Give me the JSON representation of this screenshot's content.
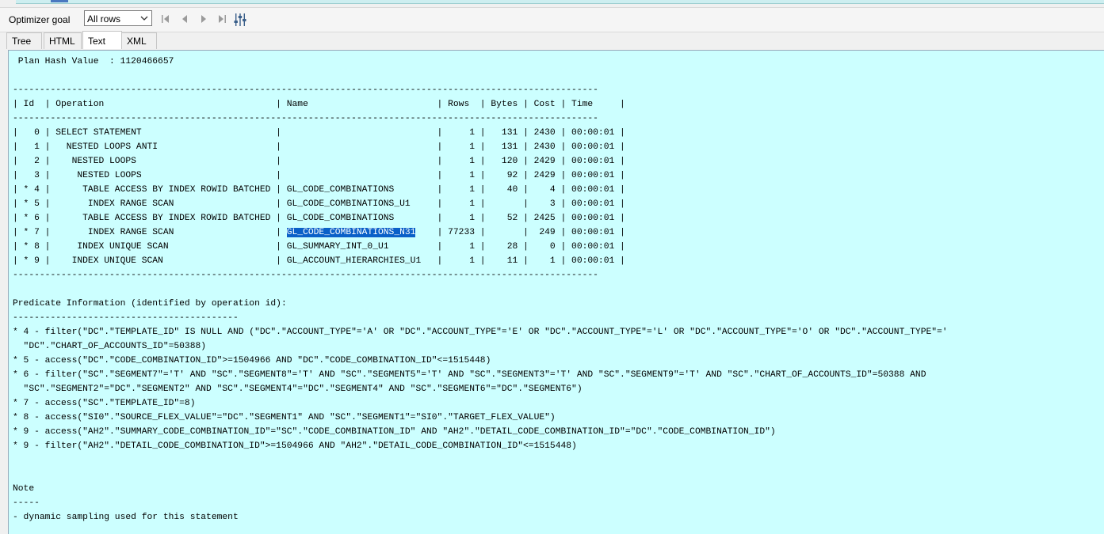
{
  "toolbar": {
    "optimizer_goal_label": "Optimizer goal",
    "optimizer_goal_value": "All rows",
    "buttons": [
      "first-page-icon",
      "previous-icon",
      "next-icon",
      "last-page-icon",
      "settings-sliders-icon"
    ]
  },
  "tabs": [
    "Tree",
    "HTML",
    "Text",
    "XML"
  ],
  "active_tab": "Text",
  "plan_text": {
    "hash_line": " Plan Hash Value  : 1120466657",
    "blank1": "",
    "sep1": "-------------------------------------------------------------------------------------------------------------",
    "header": "| Id  | Operation                                | Name                        | Rows  | Bytes | Cost | Time     |",
    "sep2": "-------------------------------------------------------------------------------------------------------------",
    "row0": "|   0 | SELECT STATEMENT                         |                             |     1 |   131 | 2430 | 00:00:01 |",
    "row1": "|   1 |   NESTED LOOPS ANTI                      |                             |     1 |   131 | 2430 | 00:00:01 |",
    "row2": "|   2 |    NESTED LOOPS                          |                             |     1 |   120 | 2429 | 00:00:01 |",
    "row3": "|   3 |     NESTED LOOPS                         |                             |     1 |    92 | 2429 | 00:00:01 |",
    "row4": "| * 4 |      TABLE ACCESS BY INDEX ROWID BATCHED | GL_CODE_COMBINATIONS        |     1 |    40 |    4 | 00:00:01 |",
    "row5": "| * 5 |       INDEX RANGE SCAN                   | GL_CODE_COMBINATIONS_U1     |     1 |       |    3 | 00:00:01 |",
    "row6": "| * 6 |      TABLE ACCESS BY INDEX ROWID BATCHED | GL_CODE_COMBINATIONS        |     1 |    52 | 2425 | 00:00:01 |",
    "row7_pre": "| * 7 |       INDEX RANGE SCAN                   | ",
    "row7_sel": "GL_CODE_COMBINATIONS_N31",
    "row7_post": "    | 77233 |       |  249 | 00:00:01 |",
    "row8": "| * 8 |     INDEX UNIQUE SCAN                    | GL_SUMMARY_INT_0_U1         |     1 |    28 |    0 | 00:00:01 |",
    "row9": "| * 9 |    INDEX UNIQUE SCAN                     | GL_ACCOUNT_HIERARCHIES_U1   |     1 |    11 |    1 | 00:00:01 |",
    "sep3": "-------------------------------------------------------------------------------------------------------------",
    "blank2": "",
    "pred_title": "Predicate Information (identified by operation id):",
    "pred_sep": "------------------------------------------",
    "p1a": "* 4 - filter(\"DC\".\"TEMPLATE_ID\" IS NULL AND (\"DC\".\"ACCOUNT_TYPE\"='A' OR \"DC\".\"ACCOUNT_TYPE\"='E' OR \"DC\".\"ACCOUNT_TYPE\"='L' OR \"DC\".\"ACCOUNT_TYPE\"='O' OR \"DC\".\"ACCOUNT_TYPE\"='",
    "p1b": "  \"DC\".\"CHART_OF_ACCOUNTS_ID\"=50388)",
    "p2": "* 5 - access(\"DC\".\"CODE_COMBINATION_ID\">=1504966 AND \"DC\".\"CODE_COMBINATION_ID\"<=1515448)",
    "p3a": "* 6 - filter(\"SC\".\"SEGMENT7\"='T' AND \"SC\".\"SEGMENT8\"='T' AND \"SC\".\"SEGMENT5\"='T' AND \"SC\".\"SEGMENT3\"='T' AND \"SC\".\"SEGMENT9\"='T' AND \"SC\".\"CHART_OF_ACCOUNTS_ID\"=50388 AND",
    "p3b": "  \"SC\".\"SEGMENT2\"=\"DC\".\"SEGMENT2\" AND \"SC\".\"SEGMENT4\"=\"DC\".\"SEGMENT4\" AND \"SC\".\"SEGMENT6\"=\"DC\".\"SEGMENT6\")",
    "p4": "* 7 - access(\"SC\".\"TEMPLATE_ID\"=8)",
    "p5": "* 8 - access(\"SI0\".\"SOURCE_FLEX_VALUE\"=\"DC\".\"SEGMENT1\" AND \"SC\".\"SEGMENT1\"=\"SI0\".\"TARGET_FLEX_VALUE\")",
    "p6": "* 9 - access(\"AH2\".\"SUMMARY_CODE_COMBINATION_ID\"=\"SC\".\"CODE_COMBINATION_ID\" AND \"AH2\".\"DETAIL_CODE_COMBINATION_ID\"=\"DC\".\"CODE_COMBINATION_ID\")",
    "p7": "* 9 - filter(\"AH2\".\"DETAIL_CODE_COMBINATION_ID\">=1504966 AND \"AH2\".\"DETAIL_CODE_COMBINATION_ID\"<=1515448)",
    "blank3": "",
    "blank4": "",
    "note_title": "Note",
    "note_sep": "-----",
    "note_text": "- dynamic sampling used for this statement"
  },
  "colors": {
    "content_bg": "#ccffff",
    "selection_bg": "#0a60c8"
  }
}
